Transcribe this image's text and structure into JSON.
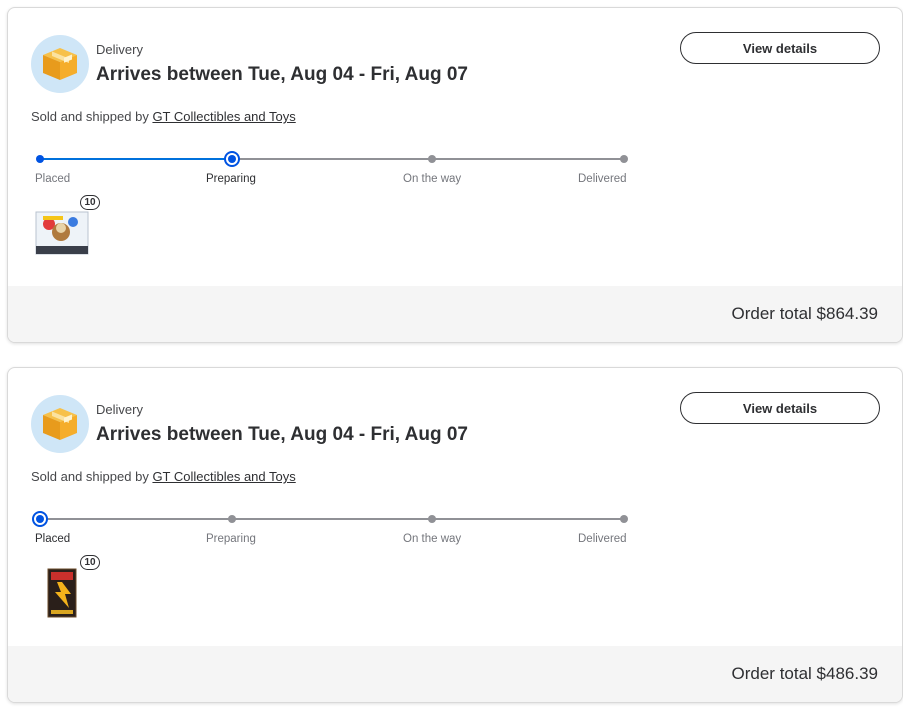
{
  "colors": {
    "progress_blue": "#0053e2",
    "track_gray": "#909196",
    "icon_bg": "#cfe6f7",
    "box_orange": "#f5a623"
  },
  "orders": [
    {
      "delivery_label": "Delivery",
      "arrival": "Arrives between Tue, Aug 04 - Fri, Aug 07",
      "view_details": "View details",
      "sold_by_prefix": "Sold and shipped by ",
      "seller": "GT Collectibles and Toys",
      "current_step": 1,
      "steps": [
        "Placed",
        "Preparing",
        "On the way",
        "Delivered"
      ],
      "quantity": "10",
      "product_icon": "trading-card-box-eevee",
      "order_total": "Order total $864.39"
    },
    {
      "delivery_label": "Delivery",
      "arrival": "Arrives between Tue, Aug 04 - Fri, Aug 07",
      "view_details": "View details",
      "sold_by_prefix": "Sold and shipped by ",
      "seller": "GT Collectibles and Toys",
      "current_step": 0,
      "steps": [
        "Placed",
        "Preparing",
        "On the way",
        "Delivered"
      ],
      "quantity": "10",
      "product_icon": "trading-card-booster-box",
      "order_total": "Order total $486.39"
    }
  ]
}
